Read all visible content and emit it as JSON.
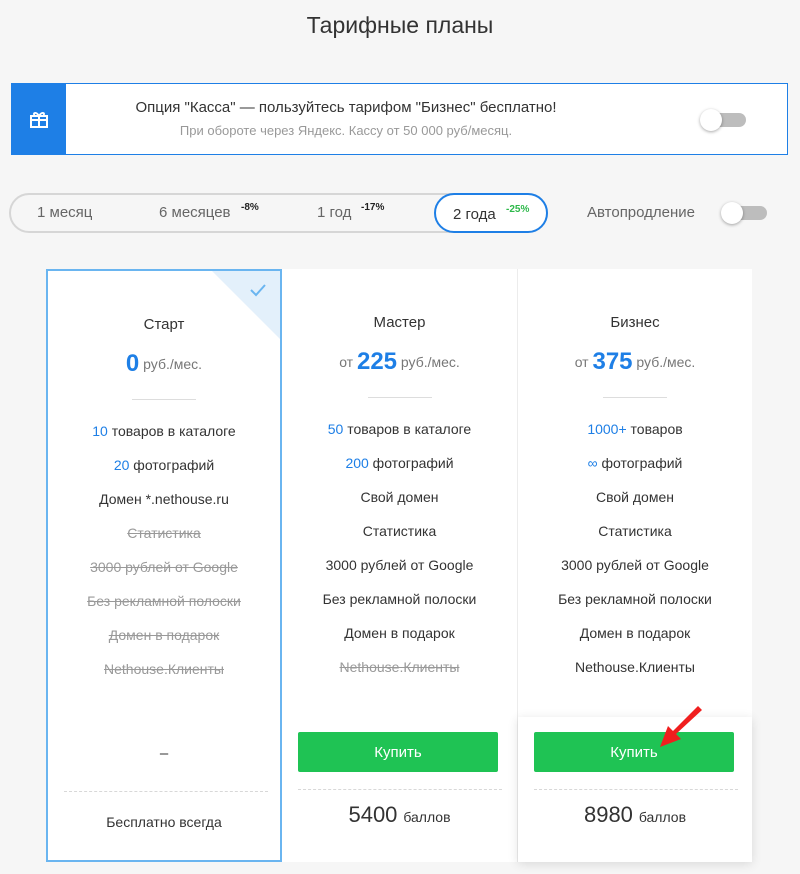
{
  "page": {
    "title": "Тарифные планы"
  },
  "promo": {
    "icon": "gift-icon",
    "title": "Опция \"Касса\" — пользуйтесь тарифом \"Бизнес\" бесплатно!",
    "subtitle": "При обороте через Яндекс. Кассу от 50 000 руб/месяц.",
    "toggle_on": false
  },
  "periods": [
    {
      "label": "1 месяц",
      "discount": "",
      "active": false
    },
    {
      "label": "6 месяцев",
      "discount": "-8%",
      "active": false
    },
    {
      "label": "1 год",
      "discount": "-17%",
      "active": false
    },
    {
      "label": "2 года",
      "discount": "-25%",
      "active": true
    }
  ],
  "autorenew": {
    "label": "Автопродление",
    "on": false
  },
  "colors": {
    "accent": "#1e7fe6",
    "buy": "#1fc354",
    "discount_active": "#2db84a",
    "arrow": "#f01e1e"
  },
  "plans": {
    "start": {
      "name": "Старт",
      "price_prefix": "",
      "price": "0",
      "unit": "руб./мес.",
      "selected": true,
      "features": {
        "f1_num": "10",
        "f1_text": " товаров в каталоге",
        "f2_num": "20",
        "f2_text": " фотографий",
        "f3": "Домен *.nethouse.ru",
        "f4": "Статистика",
        "f5": "3000 рублей от Google",
        "f6": "Без рекламной полоски",
        "f7": "Домен в подарок",
        "f8": "Nethouse.Клиенты"
      },
      "dash": "–",
      "footer": "Бесплатно всегда"
    },
    "master": {
      "name": "Мастер",
      "price_prefix": "от",
      "price": "225",
      "unit": "руб./мес.",
      "features": {
        "f1_num": "50",
        "f1_text": " товаров в каталоге",
        "f2_num": "200",
        "f2_text": " фотографий",
        "f3": "Свой домен",
        "f4": "Статистика",
        "f5": "3000 рублей от Google",
        "f6": "Без рекламной полоски",
        "f7": "Домен в подарок",
        "f8": "Nethouse.Клиенты"
      },
      "buy_label": "Купить",
      "points": "5400",
      "points_unit": "баллов"
    },
    "business": {
      "name": "Бизнес",
      "price_prefix": "от",
      "price": "375",
      "unit": "руб./мес.",
      "features": {
        "f1_num": "1000+",
        "f1_text": " товаров",
        "f2_num": "∞",
        "f2_text": " фотографий",
        "f3": "Свой домен",
        "f4": "Статистика",
        "f5": "3000 рублей от Google",
        "f6": "Без рекламной полоски",
        "f7": "Домен в подарок",
        "f8": "Nethouse.Клиенты"
      },
      "buy_label": "Купить",
      "points": "8980",
      "points_unit": "баллов"
    }
  }
}
